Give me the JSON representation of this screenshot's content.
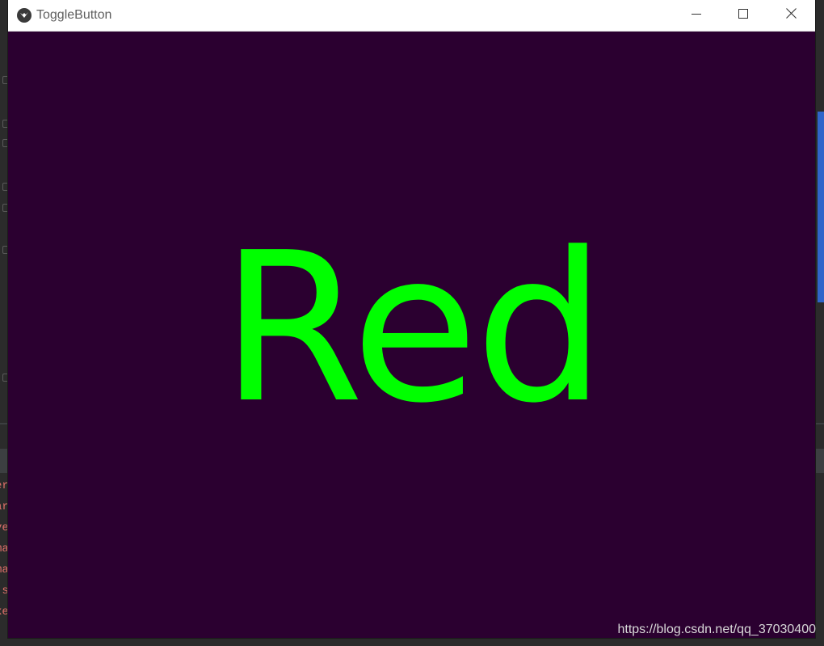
{
  "window": {
    "title": "ToggleButton",
    "icon": "kivy-logo-icon",
    "controls": {
      "minimize_icon": "minimize-icon",
      "maximize_icon": "maximize-icon",
      "close_icon": "close-icon"
    }
  },
  "toggle_button": {
    "label": "Red",
    "text_color": "#00ff00",
    "background_color": "#2b0030"
  },
  "watermark": {
    "text": "https://blog.csdn.net/qq_37030400"
  },
  "background_ide": {
    "accent_color": "#2f65ca",
    "console_text_color": "#e0706b"
  }
}
